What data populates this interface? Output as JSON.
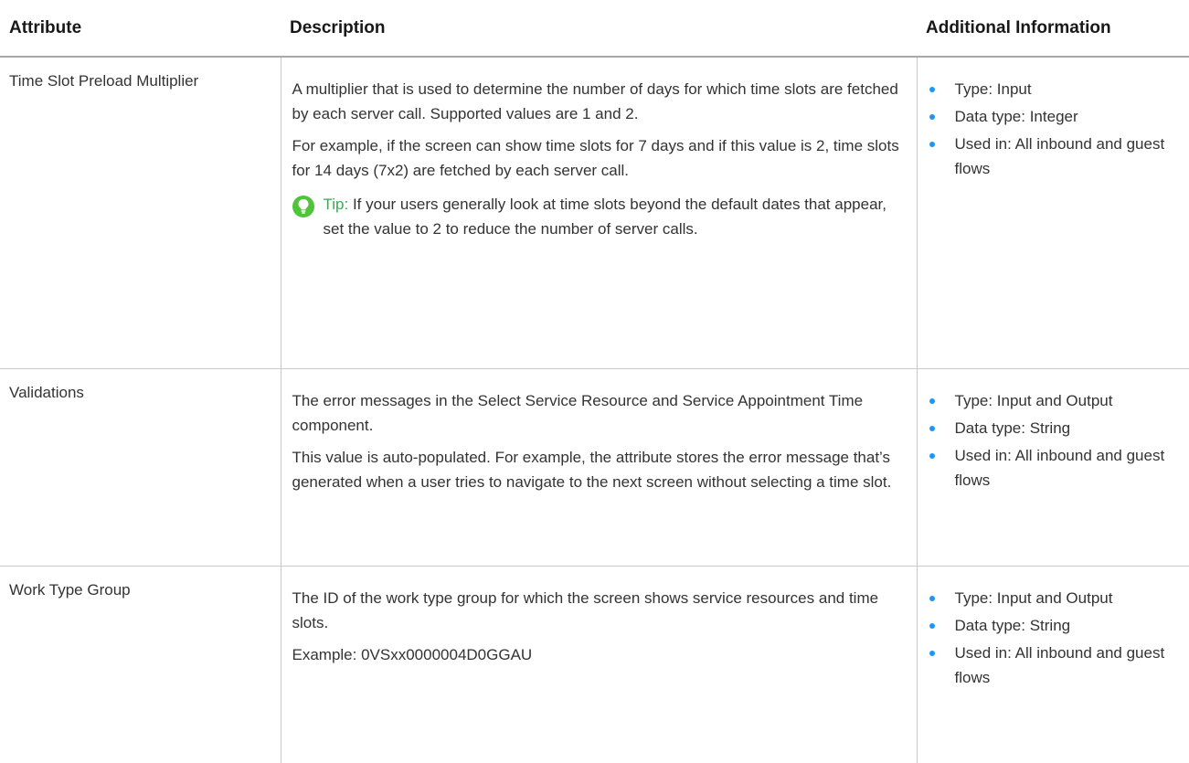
{
  "table": {
    "headers": [
      "Attribute",
      "Description",
      "Additional Information"
    ],
    "rows": [
      {
        "attribute": "Time Slot Preload Multiplier",
        "description": [
          "A multiplier that is used to determine the number of days for which time slots are fetched by each server call. Supported values are 1 and 2.",
          "For example, if the screen can show time slots for 7 days and if this value is 2, time slots for 14 days (7x2) are fetched by each server call."
        ],
        "tip": {
          "label": "Tip:",
          "text": "If your users generally look at time slots beyond the default dates that appear, set the value to 2 to reduce the number of server calls."
        },
        "info": [
          "Type: Input",
          "Data type: Integer",
          "Used in: All inbound and guest flows"
        ]
      },
      {
        "attribute": "Validations",
        "description": [
          "The error messages in the Select Service Resource and Service Appointment Time component.",
          "This value is auto-populated. For example, the attribute stores the error message that’s generated when a user tries to navigate to the next screen without selecting a time slot."
        ],
        "info": [
          "Type: Input and Output",
          "Data type: String",
          "Used in: All inbound and guest flows"
        ]
      },
      {
        "attribute": "Work Type Group",
        "description": [
          "The ID of the work type group for which the screen shows service resources and time slots.",
          "Example: 0VSxx0000004D0GGAU"
        ],
        "info": [
          "Type: Input and Output",
          "Data type: String",
          "Used in: All inbound and guest flows"
        ]
      }
    ]
  },
  "colors": {
    "bullet": "#1b96ff",
    "tip_icon": "#4fc33a",
    "tip_label": "#3ba755"
  },
  "icons": {
    "tip": "lightbulb-icon",
    "list_marker": "bullet-dot"
  }
}
